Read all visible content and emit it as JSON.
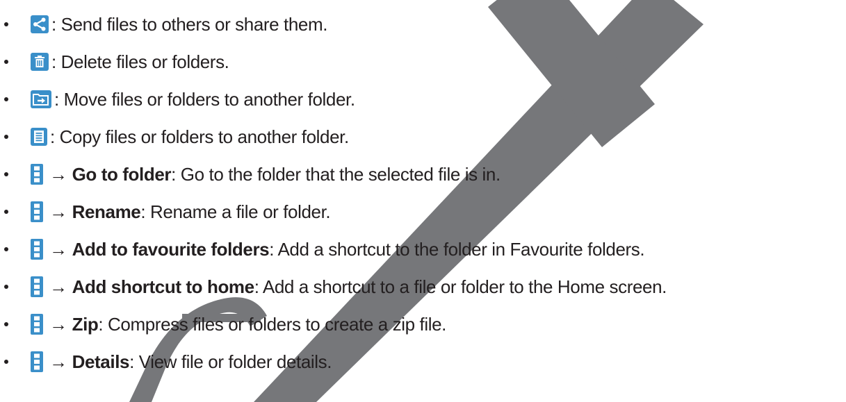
{
  "items": [
    {
      "icon": "share-icon",
      "bold": "",
      "text": ": Send files to others or share them."
    },
    {
      "icon": "delete-icon",
      "bold": "",
      "text": ": Delete files or folders."
    },
    {
      "icon": "move-icon",
      "bold": "",
      "text": ": Move files or folders to another folder."
    },
    {
      "icon": "copy-icon",
      "bold": "",
      "text": ": Copy files or folders to another folder."
    },
    {
      "icon": "more-options-icon",
      "arrow": "→",
      "bold": "Go to folder",
      "text": ": Go to the folder that the selected file is in."
    },
    {
      "icon": "more-options-icon",
      "arrow": "→",
      "bold": "Rename",
      "text": ": Rename a file or folder."
    },
    {
      "icon": "more-options-icon",
      "arrow": "→",
      "bold": "Add to favourite folders",
      "text": ": Add a shortcut to the folder in Favourite folders."
    },
    {
      "icon": "more-options-icon",
      "arrow": "→",
      "bold": "Add shortcut to home",
      "text": ": Add a shortcut to a file or folder to the Home screen."
    },
    {
      "icon": "more-options-icon",
      "arrow": "→",
      "bold": "Zip",
      "text": ": Compress files or folders to create a zip file."
    },
    {
      "icon": "more-options-icon",
      "arrow": "→",
      "bold": "Details",
      "text": ": View file or folder details."
    }
  ],
  "watermark": {
    "color": "#76777a"
  }
}
